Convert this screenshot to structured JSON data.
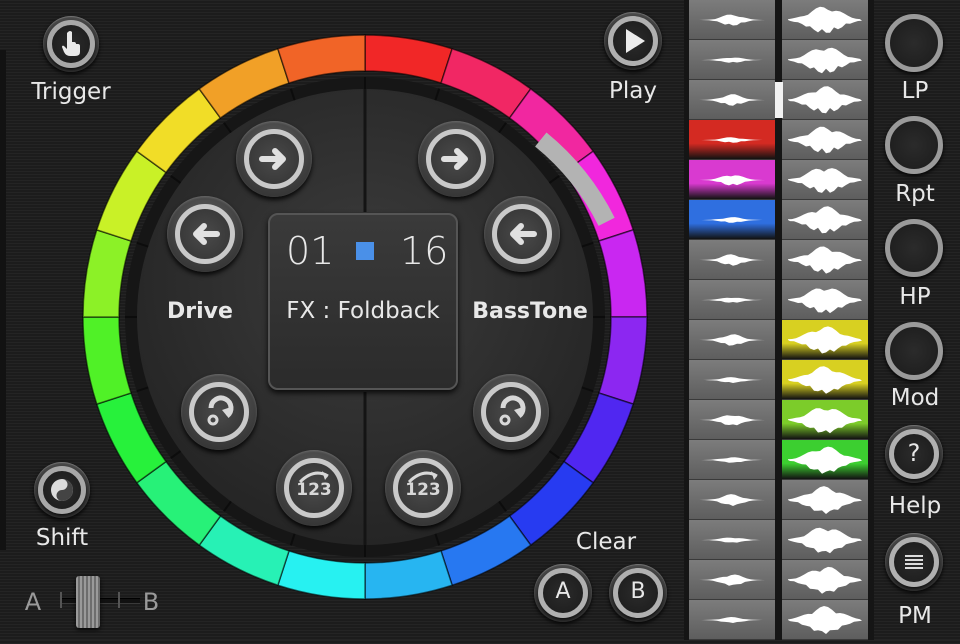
{
  "left_controls": {
    "trigger_label": "Trigger",
    "shift_label": "Shift",
    "crossfader": {
      "a_label": "A",
      "b_label": "B"
    }
  },
  "wheel": {
    "center": {
      "step_current": "01",
      "step_total": "16",
      "fx_text": "FX : Foldback"
    },
    "left_label": "Drive",
    "right_label": "BassTone",
    "counter_icon_text": "123"
  },
  "right_controls": {
    "play_label": "Play",
    "clear_label": "Clear",
    "clear_a_label": "A",
    "clear_b_label": "B"
  },
  "effects": [
    {
      "label": "LP"
    },
    {
      "label": "Rpt"
    },
    {
      "label": "HP"
    },
    {
      "label": "Mod"
    },
    {
      "label": "Help",
      "icon_text": "?"
    },
    {
      "label": "PM"
    }
  ],
  "tracks": {
    "left_highlights": [
      {
        "row": 3,
        "color": "#d42a22"
      },
      {
        "row": 4,
        "color": "#d93ad0"
      },
      {
        "row": 5,
        "color": "#2f6fe0"
      }
    ],
    "right_highlights": [
      {
        "row": 8,
        "color": "#d8d021"
      },
      {
        "row": 9,
        "color": "#d8d021"
      },
      {
        "row": 10,
        "color": "#7ccc2a"
      },
      {
        "row": 11,
        "color": "#3ccf30"
      }
    ]
  },
  "colors": {
    "center_square": "#4a90e8",
    "button_ring": "#c9c9c9"
  }
}
